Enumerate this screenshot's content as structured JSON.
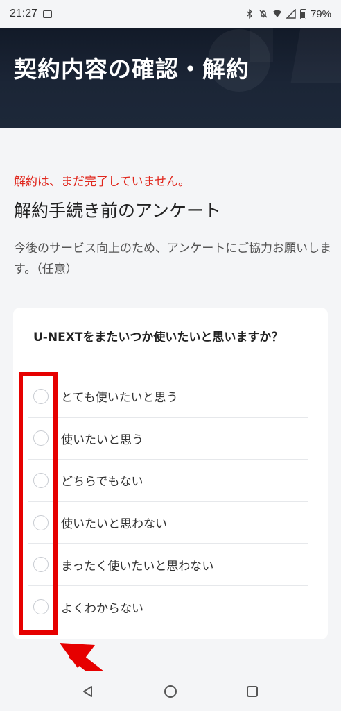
{
  "status_bar": {
    "time": "21:27",
    "icons": [
      "image-icon",
      "bluetooth-icon",
      "mute-icon",
      "wifi-icon",
      "signal-icon",
      "battery-icon"
    ],
    "battery": "79%"
  },
  "header": {
    "title": "契約内容の確認・解約"
  },
  "notice": "解約は、まだ完了していません。",
  "survey": {
    "title": "解約手続き前のアンケート",
    "description": "今後のサービス向上のため、アンケートにご協力お願いします。（任意）",
    "question": "U-NEXTをまたいつか使いたいと思いますか？",
    "options": [
      "とても使いたいと思う",
      "使いたいと思う",
      "どちらでもない",
      "使いたいと思わない",
      "まったく使いたいと思わない",
      "よくわからない"
    ]
  },
  "annotation": {
    "color": "#e60000"
  },
  "nav": {
    "buttons": [
      "back-icon",
      "home-icon",
      "recents-icon"
    ]
  }
}
